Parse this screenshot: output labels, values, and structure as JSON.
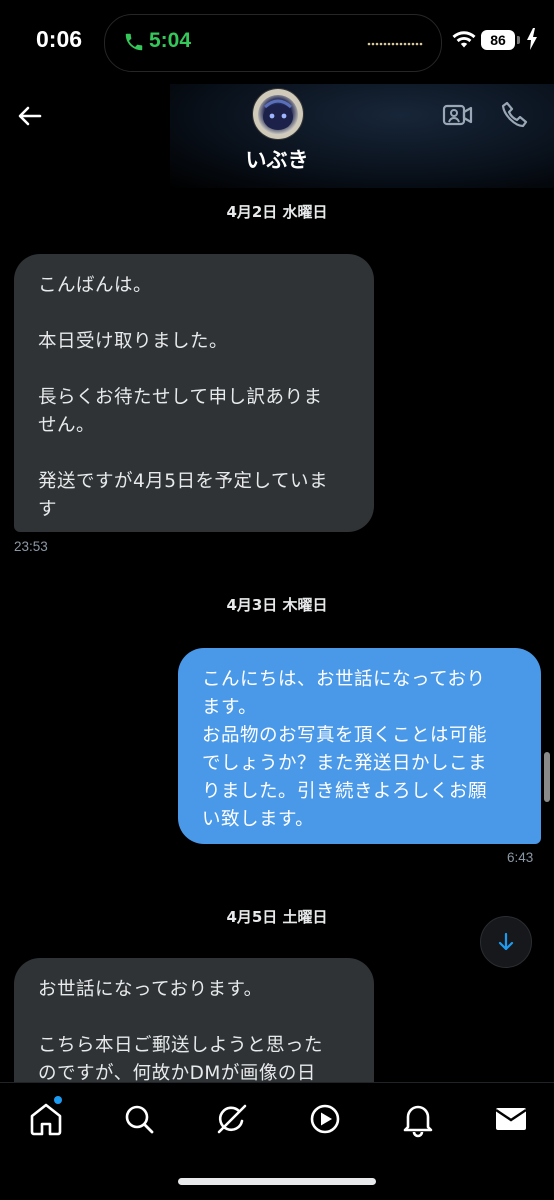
{
  "status_bar": {
    "time": "0:06",
    "call_timer": "5:04",
    "battery": "86"
  },
  "header": {
    "contact_name": "いぶき"
  },
  "conversation": {
    "groups": [
      {
        "date": "4月2日 水曜日",
        "message": "こんばんは。\n\n本日受け取りました。\n\n長らくお待たせして申し訳ありま\nせん。\n\n発送ですが4月5日を予定していま\nす",
        "time": "23:53",
        "direction": "incoming"
      },
      {
        "date": "4月3日 木曜日",
        "message": "こんにちは、お世話になっており\nます。\nお品物のお写真を頂くことは可能\nでしょうか？また発送日かしこま\nりました。引き続きよろしくお願\nい致します。",
        "time": "6:43",
        "direction": "outgoing"
      },
      {
        "date": "4月5日 土曜日",
        "message": "お世話になっております。\n\nこちら本日ご郵送しようと思った\nのですが、何故かDMが画像の日",
        "direction": "incoming"
      }
    ]
  },
  "bottom_nav": {
    "items": [
      "home-icon",
      "search-icon",
      "grok-icon",
      "video-icon",
      "notifications-icon",
      "messages-icon"
    ],
    "active": "home-icon"
  },
  "colors": {
    "background": "#000000",
    "incoming_bubble": "#2f3336",
    "outgoing_bubble": "#4a99e9",
    "call_green": "#34c759",
    "accent_blue": "#1d9bf0"
  }
}
